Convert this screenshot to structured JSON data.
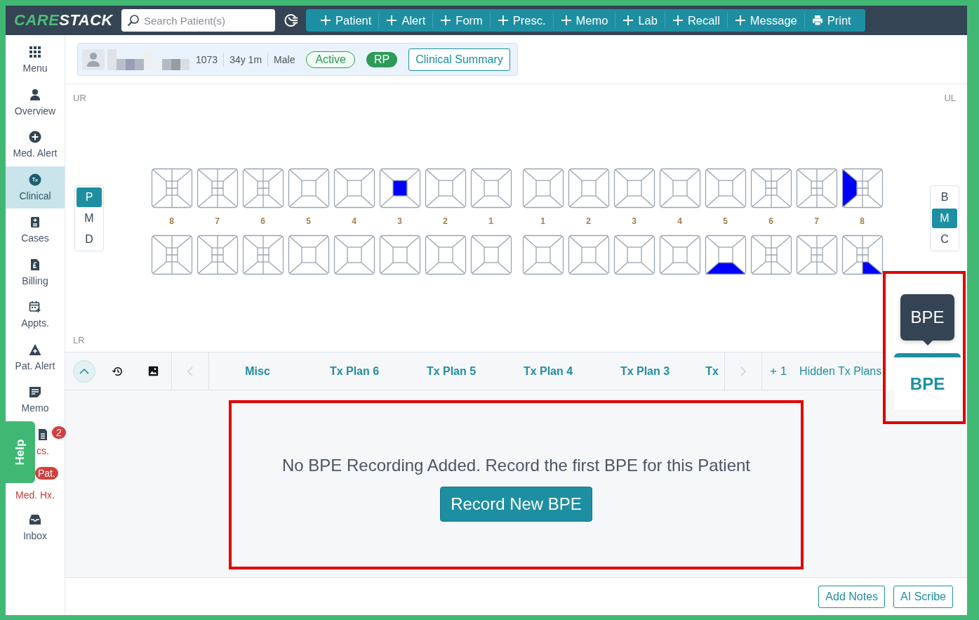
{
  "header": {
    "logo": [
      {
        "text": "CARE",
        "kind": "accent"
      },
      {
        "text": "STACK",
        "kind": "plain"
      }
    ],
    "search": {
      "placeholder": "Search Patient(s)"
    },
    "actions": [
      {
        "label": "Patient",
        "kind": "add"
      },
      {
        "label": "Alert",
        "kind": "add"
      },
      {
        "label": "Form",
        "kind": "add"
      },
      {
        "label": "Presc.",
        "kind": "add"
      },
      {
        "label": "Memo",
        "kind": "add"
      },
      {
        "label": "Lab",
        "kind": "add"
      },
      {
        "label": "Recall",
        "kind": "add"
      },
      {
        "label": "Message",
        "kind": "add"
      },
      {
        "label": "Print",
        "kind": "print"
      }
    ]
  },
  "sidebar": {
    "items": [
      {
        "label": "Menu",
        "kind": "grid",
        "selected": false,
        "alert": false
      },
      {
        "label": "Overview",
        "kind": "person",
        "selected": false,
        "alert": false
      },
      {
        "label": "Med. Alert",
        "kind": "plus",
        "selected": false,
        "alert": false
      },
      {
        "label": "Clinical",
        "kind": "tx",
        "selected": true,
        "alert": false
      },
      {
        "label": "Cases",
        "kind": "clipboard",
        "selected": false,
        "alert": false
      },
      {
        "label": "Billing",
        "kind": "bill",
        "selected": false,
        "alert": false
      },
      {
        "label": "Appts.",
        "kind": "calendar",
        "selected": false,
        "alert": false
      },
      {
        "label": "Pat. Alert",
        "kind": "warning",
        "selected": false,
        "alert": false
      },
      {
        "label": "Memo",
        "kind": "memo",
        "selected": false,
        "alert": false
      },
      {
        "label": "cs.",
        "kind": "docs",
        "selected": false,
        "alert": true,
        "badge": "2"
      },
      {
        "label": "Med. Hx.",
        "kind": "none",
        "selected": false,
        "alert": true,
        "badge": "Pat."
      },
      {
        "label": "Inbox",
        "kind": "inbox",
        "selected": false,
        "alert": false
      }
    ],
    "help_tab": "Help"
  },
  "patient": {
    "id": "1073",
    "age": "34y 1m",
    "sex": "Male",
    "status": "Active",
    "badge": "RP",
    "summary_button": "Clinical Summary"
  },
  "chart": {
    "upper_right_label": "UR",
    "upper_left_label": "UL",
    "lower_right_label": "LR",
    "left_modes": [
      {
        "label": "P",
        "selected": true
      },
      {
        "label": "M",
        "selected": false
      },
      {
        "label": "D",
        "selected": false
      }
    ],
    "right_modes": [
      {
        "label": "B",
        "selected": false
      },
      {
        "label": "M",
        "selected": true
      },
      {
        "label": "C",
        "selected": false
      }
    ],
    "tooth_numbers": [
      "8",
      "7",
      "6",
      "5",
      "4",
      "3",
      "2",
      "1",
      "1",
      "2",
      "3",
      "4",
      "5",
      "6",
      "7",
      "8"
    ],
    "upper": [
      {
        "kind": "molar"
      },
      {
        "kind": "molar"
      },
      {
        "kind": "molar"
      },
      {
        "kind": "plain"
      },
      {
        "kind": "plain"
      },
      {
        "kind": "plain",
        "center_filled": true
      },
      {
        "kind": "plain"
      },
      {
        "kind": "plain"
      },
      {
        "kind": "plain"
      },
      {
        "kind": "plain"
      },
      {
        "kind": "plain"
      },
      {
        "kind": "plain"
      },
      {
        "kind": "plain"
      },
      {
        "kind": "molar"
      },
      {
        "kind": "molar"
      },
      {
        "kind": "molar",
        "left_filled": true
      }
    ],
    "lower": [
      {
        "kind": "molar"
      },
      {
        "kind": "molar"
      },
      {
        "kind": "molar"
      },
      {
        "kind": "plain"
      },
      {
        "kind": "plain"
      },
      {
        "kind": "plain"
      },
      {
        "kind": "plain"
      },
      {
        "kind": "plain"
      },
      {
        "kind": "plain"
      },
      {
        "kind": "plain"
      },
      {
        "kind": "plain"
      },
      {
        "kind": "plain"
      },
      {
        "kind": "plain",
        "bottom_filled": true
      },
      {
        "kind": "molar"
      },
      {
        "kind": "molar"
      },
      {
        "kind": "molar",
        "bottom_right_filled": true
      }
    ]
  },
  "plan_tabs": {
    "items": [
      {
        "label": "Misc",
        "selected": false
      },
      {
        "label": "Tx Plan 6",
        "selected": false
      },
      {
        "label": "Tx Plan 5",
        "selected": false
      },
      {
        "label": "Tx Plan 4",
        "selected": false
      },
      {
        "label": "Tx Plan 3",
        "selected": false
      },
      {
        "label": "Tx",
        "selected": false
      }
    ],
    "hidden_count": "+ 1",
    "hidden_label": "Hidden Tx Plans"
  },
  "bpe_tab": {
    "label": "BPE",
    "selected": true,
    "tooltip": "BPE",
    "highlighted": true
  },
  "empty_state": {
    "message": "No BPE Recording Added. Record the first BPE for this Patient",
    "button": "Record New BPE",
    "highlighted": true
  },
  "footer": {
    "buttons": [
      "Add Notes",
      "AI Scribe"
    ]
  }
}
